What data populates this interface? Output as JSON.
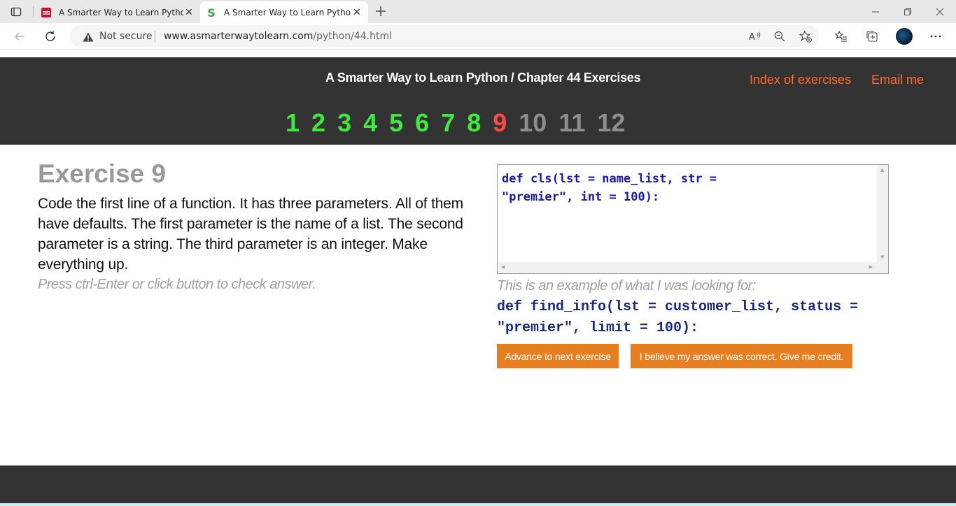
{
  "browser": {
    "tabs": [
      {
        "title": "A Smarter Way to Learn Python -",
        "icon": "pdf-icon",
        "active": false
      },
      {
        "title": "A Smarter Way to Learn Python -",
        "icon": "site-s-icon",
        "active": true
      }
    ],
    "address": {
      "security_label": "Not secure",
      "url_host": "www.asmarterwaytolearn.com",
      "url_path": "/python/44.html"
    }
  },
  "header": {
    "title": "A Smarter Way to Learn Python / Chapter 44 Exercises",
    "links": {
      "index": "Index of exercises",
      "email": "Email me"
    },
    "exercise_numbers": [
      {
        "label": "1",
        "state": "done"
      },
      {
        "label": "2",
        "state": "done"
      },
      {
        "label": "3",
        "state": "done"
      },
      {
        "label": "4",
        "state": "done"
      },
      {
        "label": "5",
        "state": "done"
      },
      {
        "label": "6",
        "state": "done"
      },
      {
        "label": "7",
        "state": "done"
      },
      {
        "label": "8",
        "state": "done"
      },
      {
        "label": "9",
        "state": "current"
      },
      {
        "label": "10",
        "state": "todo"
      },
      {
        "label": "11",
        "state": "todo"
      },
      {
        "label": "12",
        "state": "todo"
      }
    ]
  },
  "exercise": {
    "title": "Exercise 9",
    "prompt": "Code the first line of a function. It has three parameters. All of them have defaults. The first parameter is the name of a list. The second parameter is a string. The third parameter is an integer. Make everything up.",
    "hint": "Press ctrl-Enter or click button to check answer.",
    "answer": "def cls(lst = name_list, str = \n\"premier\", int = 100):",
    "example_label": "This is an example of what I was looking for:",
    "example_code": "def find_info(lst = customer_list, status =\n\"premier\", limit = 100):",
    "buttons": {
      "advance": "Advance to next exercise",
      "credit": "I believe my answer was correct. Give me credit."
    }
  },
  "colors": {
    "header_bg": "#333333",
    "link": "#ff6a30",
    "done": "#3ee83e",
    "current": "#ff4a4a",
    "todo": "#8e8e8e",
    "button": "#e67e22"
  }
}
